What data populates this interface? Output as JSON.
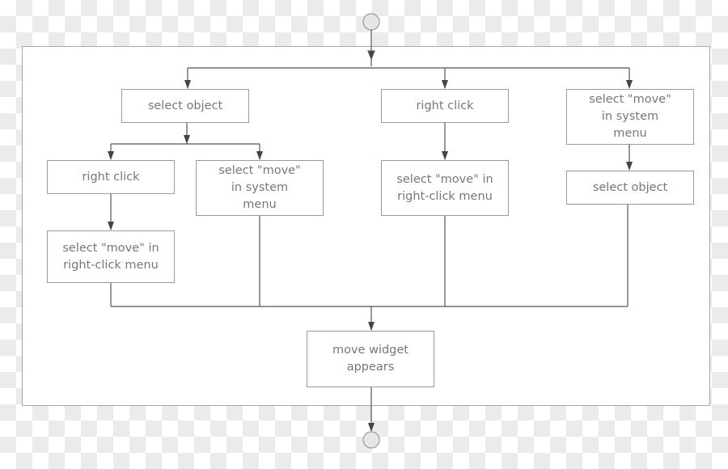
{
  "nodes": {
    "select_object_1": "select object",
    "right_click_col2": "right click",
    "select_move_system_col4": "select \"move\" in system menu",
    "right_click_col1": "right click",
    "select_move_system_col1b": "select \"move\" in system menu",
    "select_move_rightclick_col2": "select \"move\" in right-click menu",
    "select_object_col4": "select object",
    "select_move_rightclick_col1": "select \"move\" in right-click menu",
    "move_widget_appears": "move widget appears"
  },
  "colors": {
    "line": "#444444",
    "box_border": "#9a9a9a",
    "text": "#777777",
    "terminal_fill": "#e6e6e6"
  }
}
